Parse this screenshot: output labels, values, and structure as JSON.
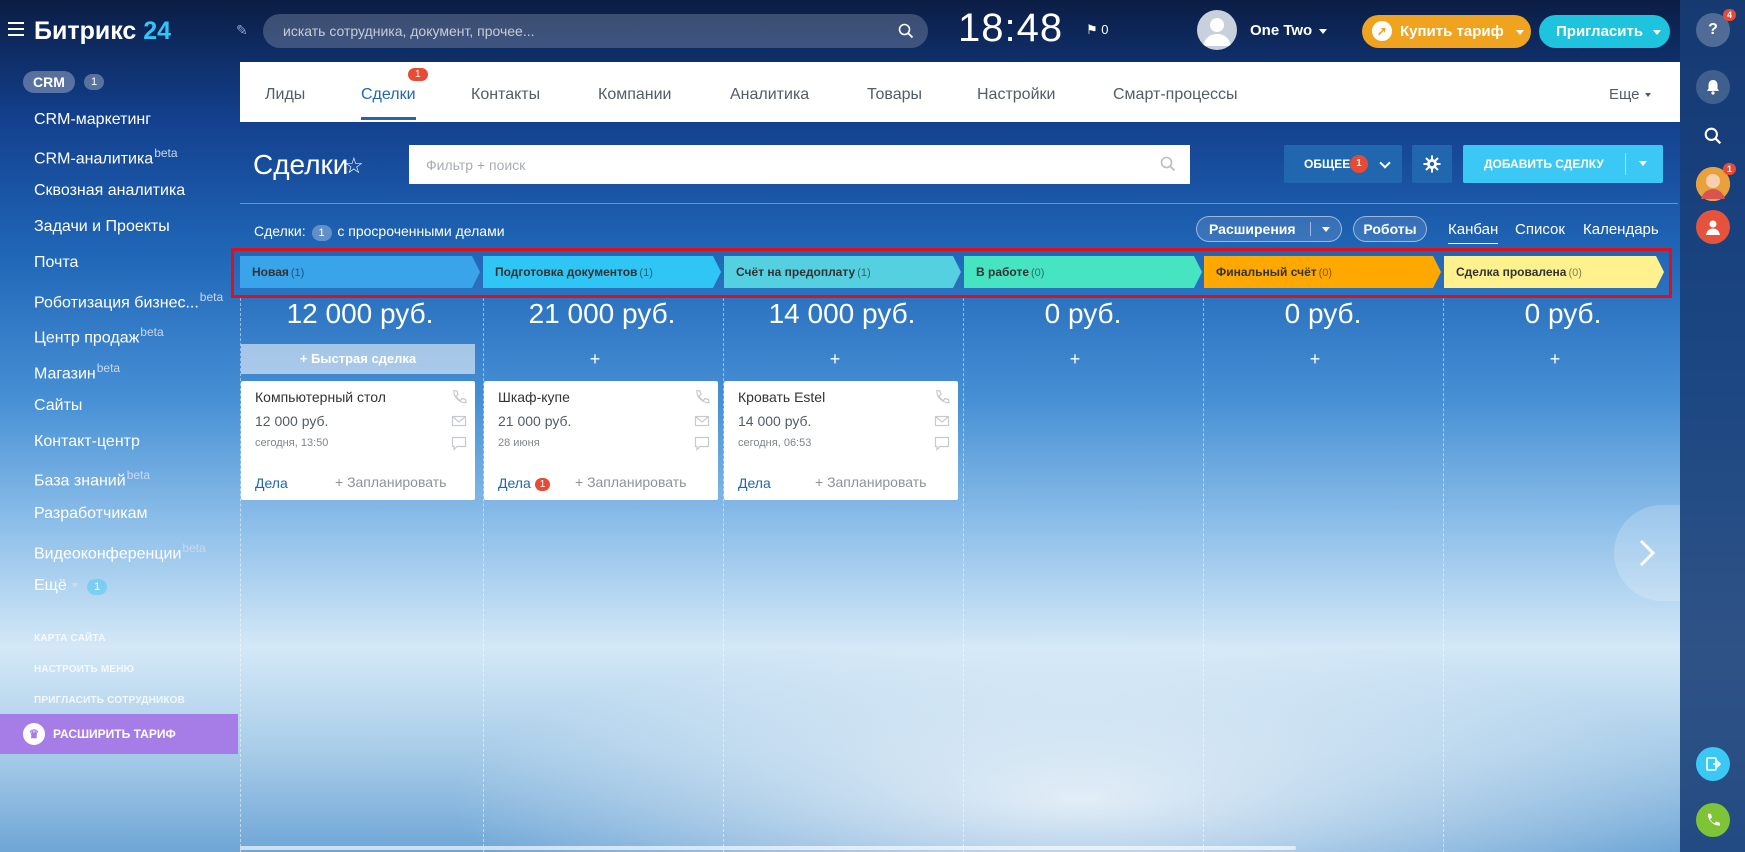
{
  "header": {
    "logo_main": "Битрикс",
    "logo_num": "24",
    "search_placeholder": "искать сотрудника, документ, прочее...",
    "clock": "18:48",
    "flag_count": "0",
    "user_name": "One Two",
    "buy_label": "Купить тариф",
    "invite_label": "Пригласить"
  },
  "sidebar": {
    "crm_label": "CRM",
    "crm_count": "1",
    "items": [
      {
        "label": "CRM-маркетинг",
        "sup": ""
      },
      {
        "label": "CRM-аналитика",
        "sup": "beta"
      },
      {
        "label": "Сквозная аналитика",
        "sup": ""
      },
      {
        "label": "Задачи и Проекты",
        "sup": ""
      },
      {
        "label": "Почта",
        "sup": ""
      },
      {
        "label": "Роботизация бизнес...",
        "sup": "beta"
      },
      {
        "label": "Центр продаж",
        "sup": "beta"
      },
      {
        "label": "Магазин",
        "sup": "beta"
      },
      {
        "label": "Сайты",
        "sup": ""
      },
      {
        "label": "Контакт-центр",
        "sup": ""
      },
      {
        "label": "База знаний",
        "sup": "beta"
      },
      {
        "label": "Разработчикам",
        "sup": ""
      },
      {
        "label": "Видеоконференции",
        "sup": "beta"
      }
    ],
    "more_label": "Ещё",
    "more_count": "1",
    "sitemap": "КАРТА САЙТА",
    "setup_menu": "НАСТРОИТЬ МЕНЮ",
    "invite_staff": "ПРИГЛАСИТЬ СОТРУДНИКОВ",
    "upgrade": "РАСШИРИТЬ ТАРИФ"
  },
  "tabs": [
    {
      "label": "Лиды",
      "badge": ""
    },
    {
      "label": "Сделки",
      "badge": "1"
    },
    {
      "label": "Контакты",
      "badge": ""
    },
    {
      "label": "Компании",
      "badge": ""
    },
    {
      "label": "Аналитика",
      "badge": ""
    },
    {
      "label": "Товары",
      "badge": ""
    },
    {
      "label": "Настройки",
      "badge": ""
    },
    {
      "label": "Смарт-процессы",
      "badge": ""
    }
  ],
  "tabs_more": "Еще",
  "toolbar": {
    "title": "Сделки",
    "filter_placeholder": "Фильтр + поиск",
    "common_label": "ОБЩЕЕ",
    "common_badge": "1",
    "add_label": "ДОБАВИТЬ СДЕЛКУ"
  },
  "overdue": {
    "prefix": "Сделки:",
    "count": "1",
    "suffix": "с просроченными делами"
  },
  "extensions_label": "Расширения",
  "robots_label": "Роботы",
  "views": [
    "Канбан",
    "Список",
    "Календарь"
  ],
  "stages": [
    {
      "name": "Новая",
      "count": "(1)",
      "sum": "12 000 руб.",
      "color": "#3aa4ea"
    },
    {
      "name": "Подготовка документов",
      "count": "(1)",
      "sum": "21 000 руб.",
      "color": "#2fc6f6"
    },
    {
      "name": "Счёт на предоплату",
      "count": "(1)",
      "sum": "14 000 руб.",
      "color": "#55d0e0"
    },
    {
      "name": "В работе",
      "count": "(0)",
      "sum": "0 руб.",
      "color": "#47e4c2"
    },
    {
      "name": "Финальный счёт",
      "count": "(0)",
      "sum": "0 руб.",
      "color": "#ffa900"
    },
    {
      "name": "Сделка провалена",
      "count": "(0)",
      "sum": "0 руб.",
      "color": "#fff28e"
    }
  ],
  "quick_deal": "+ Быстрая сделка",
  "plus": "+",
  "cards": [
    {
      "title": "Компьютерный стол",
      "price": "12 000 руб.",
      "date": "сегодня, 13:50",
      "tasks": "Дела",
      "tasks_badge": "",
      "plan": "+ Запланировать"
    },
    {
      "title": "Шкаф-купе",
      "price": "21 000 руб.",
      "date": "28 июня",
      "tasks": "Дела",
      "tasks_badge": "1",
      "plan": "+ Запланировать"
    },
    {
      "title": "Кровать Estel",
      "price": "14 000 руб.",
      "date": "сегодня, 06:53",
      "tasks": "Дела",
      "tasks_badge": "",
      "plan": "+ Запланировать"
    }
  ],
  "right_panel": {
    "help_badge": "4",
    "avatar_badge": "1"
  }
}
